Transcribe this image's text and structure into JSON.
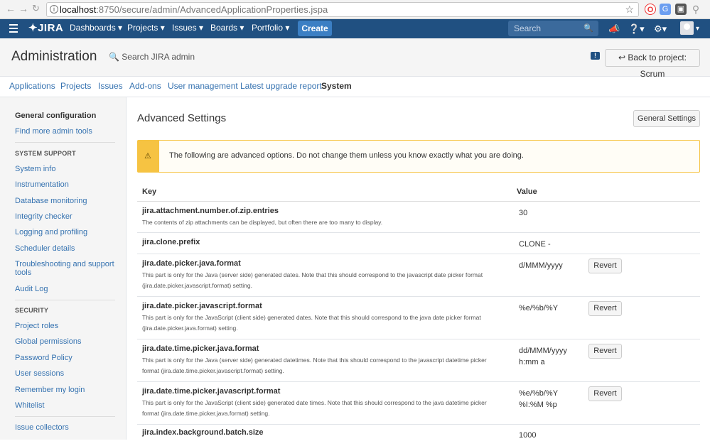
{
  "browser": {
    "url_host": "localhost",
    "url_path": ":8750/secure/admin/AdvancedApplicationProperties.jspa"
  },
  "topnav": {
    "logo": "JIRA",
    "menus": [
      "Dashboards",
      "Projects",
      "Issues",
      "Boards",
      "Portfolio"
    ],
    "create": "Create",
    "search_placeholder": "Search"
  },
  "admin": {
    "title": "Administration",
    "search": "Search JIRA admin",
    "back": "Back to project: Scrum"
  },
  "tabs": [
    "Applications",
    "Projects",
    "Issues",
    "Add-ons",
    "User management",
    "Latest upgrade report",
    "System"
  ],
  "sidebar": {
    "general_header": "General configuration",
    "find_more": "Find more admin tools",
    "system_support": "SYSTEM SUPPORT",
    "support_items": [
      "System info",
      "Instrumentation",
      "Database monitoring",
      "Integrity checker",
      "Logging and profiling",
      "Scheduler details",
      "Troubleshooting and support",
      "tools",
      "Audit Log"
    ],
    "security": "SECURITY",
    "security_items": [
      "Project roles",
      "Global permissions",
      "Password Policy",
      "User sessions",
      "Remember my login",
      "Whitelist"
    ],
    "issue_collectors": "Issue collectors"
  },
  "main": {
    "title": "Advanced Settings",
    "general_settings": "General Settings",
    "warning": "The following are advanced options. Do not change them unless you know exactly what you are doing.",
    "col_key": "Key",
    "col_value": "Value",
    "revert": "Revert",
    "rows": [
      {
        "key": "jira.attachment.number.of.zip.entries",
        "desc1": "The contents of zip attachments can be displayed, but often there are too many to display.",
        "desc2": "",
        "val1": "30",
        "val2": ""
      },
      {
        "key": "jira.clone.prefix",
        "desc1": "",
        "desc2": "",
        "val1": "CLONE -",
        "val2": ""
      },
      {
        "key": "jira.date.picker.java.format",
        "desc1": "This part is only for the Java (server side) generated dates. Note that this should correspond to the javascript date picker format",
        "desc2": "(jira.date.picker.javascript.format) setting.",
        "val1": "d/MMM/yyyy",
        "val2": ""
      },
      {
        "key": "jira.date.picker.javascript.format",
        "desc1": "This part is only for the JavaScript (client side) generated dates. Note that this should correspond to the java date picker format",
        "desc2": "(jira.date.picker.java.format) setting.",
        "val1": "%e/%b/%Y",
        "val2": ""
      },
      {
        "key": "jira.date.time.picker.java.format",
        "desc1": "This part is only for the Java (server side) generated datetimes. Note that this should correspond to the javascript datetime picker",
        "desc2": "format (jira.date.time.picker.javascript.format) setting.",
        "val1": "dd/MMM/yyyy",
        "val2": "h:mm a"
      },
      {
        "key": "jira.date.time.picker.javascript.format",
        "desc1": "This part is only for the JavaScript (client side) generated date times. Note that this should correspond to the java datetime picker",
        "desc2": "format (jira.date.time.picker.java.format) setting.",
        "val1": "%e/%b/%Y",
        "val2": "%I:%M %p"
      },
      {
        "key": "jira.index.background.batch.size",
        "desc1": "",
        "desc2": "",
        "val1": "1000",
        "val2": ""
      }
    ]
  }
}
